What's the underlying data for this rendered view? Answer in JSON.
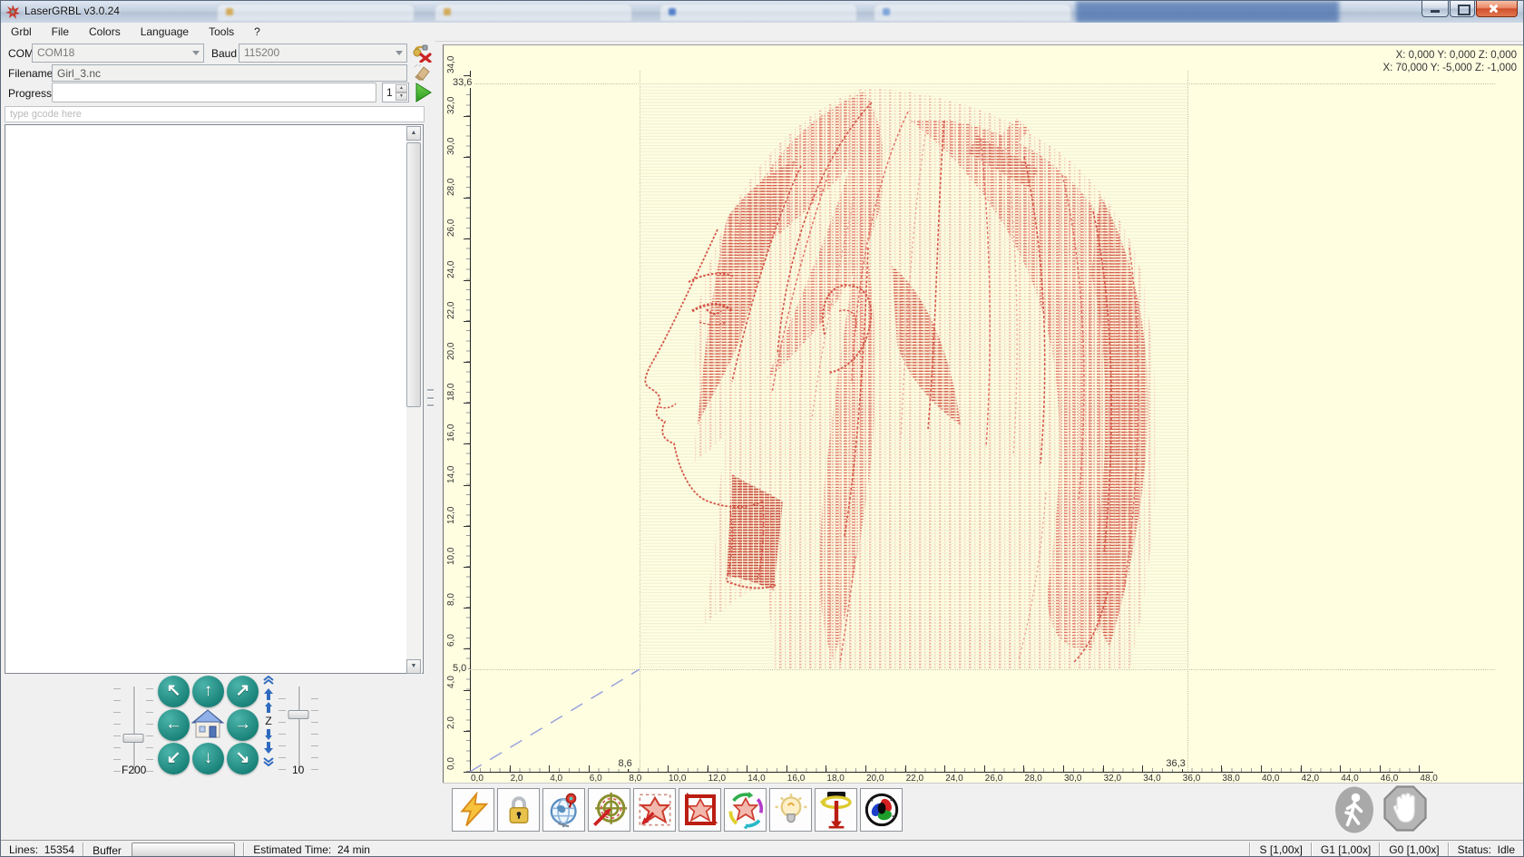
{
  "window": {
    "title": "LaserGRBL v3.0.24"
  },
  "menu": {
    "items": [
      "Grbl",
      "File",
      "Colors",
      "Language",
      "Tools",
      "?"
    ]
  },
  "connection": {
    "com_label": "COM",
    "com_value": "COM18",
    "baud_label": "Baud",
    "baud_value": "115200"
  },
  "file": {
    "filename_label": "Filename",
    "filename_value": "Girl_3.nc"
  },
  "progress": {
    "label": "Progress",
    "passes_value": "1"
  },
  "gcode_input": {
    "placeholder": "type gcode here"
  },
  "jog": {
    "feed_label": "F200",
    "z_label": "Z",
    "step_label": "10"
  },
  "preview": {
    "coords_line1": "X: 0,000 Y: 0,000 Z: 0,000",
    "coords_line2": "X: 70,000 Y: -5,000 Z: -1,000",
    "x_ticks": [
      "0,0",
      "2,0",
      "4,0",
      "6,0",
      "8,0",
      "10,0",
      "12,0",
      "14,0",
      "16,0",
      "18,0",
      "20,0",
      "22,0",
      "24,0",
      "26,0",
      "28,0",
      "30,0",
      "32,0",
      "34,0",
      "36,0",
      "38,0",
      "40,0",
      "42,0",
      "44,0",
      "46,0",
      "48,0"
    ],
    "y_ticks": [
      "0,0",
      "2,0",
      "4,0",
      "6,0",
      "8,0",
      "10,0",
      "12,0",
      "14,0",
      "16,0",
      "18,0",
      "20,0",
      "22,0",
      "24,0",
      "26,0",
      "28,0",
      "30,0",
      "32,0",
      "34,0"
    ],
    "bounds": {
      "left_label": "8,6",
      "right_label": "36,3",
      "top_label": "33,6",
      "bottom_label": "5,0"
    },
    "colors": {
      "background": "#fffee1",
      "engrave": "#d4584a",
      "accent_teal": "#1f8d84",
      "rapid_move": "#9aa2dd"
    }
  },
  "toolbar": {
    "icons": [
      "grbl-reset-lightning",
      "unlock",
      "homing-globe",
      "set-zero-target",
      "frame-outline",
      "frame-bounding-box",
      "frame-repeat",
      "laser-focus-bulb",
      "zprobe-spindle",
      "blink-rgb",
      "job-run-disabled",
      "job-abort-disabled"
    ]
  },
  "statusbar": {
    "lines_label": "Lines:",
    "lines_value": "15354",
    "buffer_label": "Buffer",
    "time_label": "Estimated Time:",
    "time_value": "24 min",
    "s_scale": "S [1,00x]",
    "g1_scale": "G1 [1,00x]",
    "g0_scale": "G0 [1,00x]",
    "status_label": "Status:",
    "status_value": "Idle"
  }
}
